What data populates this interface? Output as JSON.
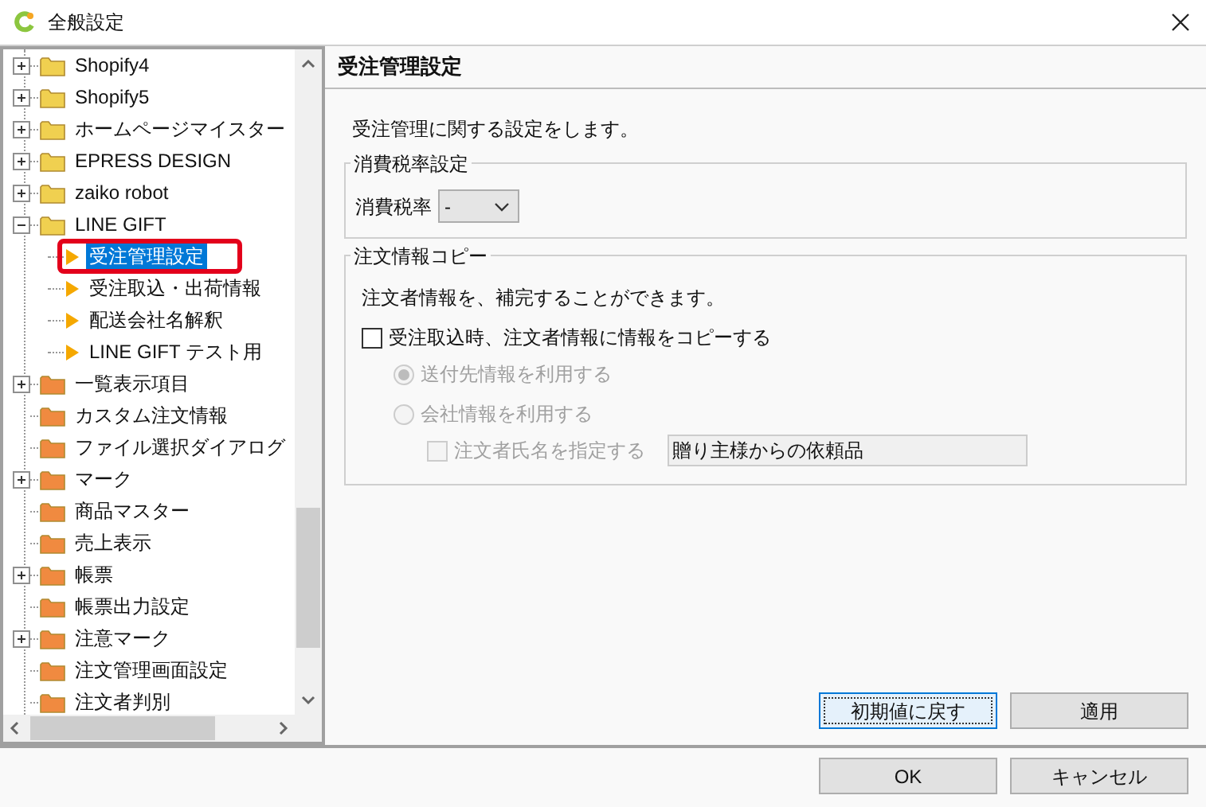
{
  "window": {
    "title": "全般設定"
  },
  "tree": [
    {
      "label": "Shopify4",
      "kind": "folder",
      "color": "#f0d050",
      "expanded": false
    },
    {
      "label": "Shopify5",
      "kind": "folder",
      "color": "#f0d050",
      "expanded": false
    },
    {
      "label": "ホームページマイスター",
      "kind": "folder",
      "color": "#f0d050",
      "expanded": false
    },
    {
      "label": "EPRESS DESIGN",
      "kind": "folder",
      "color": "#f0d050",
      "expanded": false
    },
    {
      "label": "zaiko robot",
      "kind": "folder",
      "color": "#f0d050",
      "expanded": false
    },
    {
      "label": "LINE GIFT",
      "kind": "folder",
      "color": "#f0d050",
      "expanded": true,
      "children": [
        {
          "label": "受注管理設定",
          "kind": "leaf",
          "selected": true,
          "highlighted": true
        },
        {
          "label": "受注取込・出荷情報",
          "kind": "leaf",
          "selected": false,
          "highlighted": false
        },
        {
          "label": "配送会社名解釈",
          "kind": "leaf",
          "selected": false,
          "highlighted": false
        },
        {
          "label": "LINE GIFT テスト用",
          "kind": "leaf",
          "selected": false,
          "highlighted": false
        }
      ]
    },
    {
      "label": "一覧表示項目",
      "kind": "folder",
      "color": "#f08a40",
      "expanded": false
    },
    {
      "label": "カスタム注文情報",
      "kind": "folder",
      "color": "#f08a40"
    },
    {
      "label": "ファイル選択ダイアログ",
      "kind": "folder",
      "color": "#f08a40"
    },
    {
      "label": "マーク",
      "kind": "folder",
      "color": "#f08a40",
      "expanded": false
    },
    {
      "label": "商品マスター",
      "kind": "folder",
      "color": "#f08a40"
    },
    {
      "label": "売上表示",
      "kind": "folder",
      "color": "#f08a40"
    },
    {
      "label": "帳票",
      "kind": "folder",
      "color": "#f08a40",
      "expanded": false
    },
    {
      "label": "帳票出力設定",
      "kind": "folder",
      "color": "#f08a40"
    },
    {
      "label": "注意マーク",
      "kind": "folder",
      "color": "#f08a40",
      "expanded": false
    },
    {
      "label": "注文管理画面設定",
      "kind": "folder",
      "color": "#f08a40"
    },
    {
      "label": "注文者判別",
      "kind": "folder",
      "color": "#f08a40"
    }
  ],
  "panel": {
    "heading": "受注管理設定",
    "description": "受注管理に関する設定をします。",
    "tax_group": {
      "legend": "消費税率設定",
      "label": "消費税率",
      "value": "-"
    },
    "copy_group": {
      "legend": "注文情報コピー",
      "note": "注文者情報を、補完することができます。",
      "copy_checkbox": {
        "label": "受注取込時、注文者情報に情報をコピーする",
        "checked": false
      },
      "radios": [
        {
          "label": "送付先情報を利用する",
          "selected": true,
          "disabled": true
        },
        {
          "label": "会社情報を利用する",
          "selected": false,
          "disabled": true
        }
      ],
      "name_checkbox": {
        "label": "注文者氏名を指定する",
        "checked": false,
        "disabled": true
      },
      "name_field": {
        "value": "贈り主様からの依頼品",
        "disabled": true
      }
    }
  },
  "panel_buttons": [
    {
      "label": "初期値に戻す",
      "focused": true
    },
    {
      "label": "適用",
      "focused": false
    }
  ],
  "dialog_buttons": [
    {
      "label": "OK"
    },
    {
      "label": "キャンセル"
    }
  ]
}
